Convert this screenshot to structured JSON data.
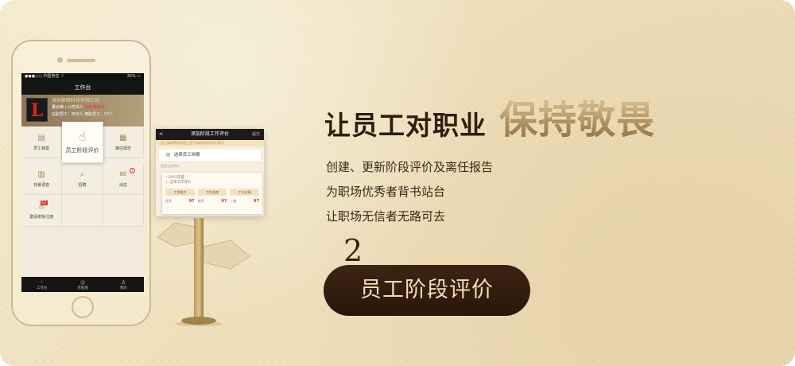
{
  "phone": {
    "status_carrier": "●●●○○ 中国电信 ⌔",
    "status_battery": "35% ▭",
    "app_title": "工作台",
    "company": {
      "logo_letter": "L",
      "name": "深圳泉眼科技有限公司",
      "owner_line": "董云峰 | 公司法人",
      "cert_status": "认证审核中",
      "stats_line": "在职员工：850人  离职员工：57人"
    },
    "grid": [
      {
        "label": "员工档案",
        "icon": "folder-icon"
      },
      {
        "label": "员工阶段评价",
        "icon": "thumbs-up-icon"
      },
      {
        "label": "离任报告",
        "icon": "report-icon"
      },
      {
        "label": "背景调查",
        "icon": "document-icon"
      },
      {
        "label": "招聘",
        "icon": "search-icon"
      },
      {
        "label": "消息",
        "icon": "mail-icon"
      },
      {
        "label": "邀请老板注册",
        "icon": "invite-icon"
      }
    ],
    "grid_badge": "2",
    "invite_tag": "5元",
    "tabs": [
      {
        "label": "工作台",
        "icon": "grid-icon"
      },
      {
        "label": "老板圈",
        "icon": "circle-icon"
      },
      {
        "label": "我的",
        "icon": "person-icon"
      }
    ]
  },
  "popup": {
    "title": "添加阶段工作评价",
    "back": "<",
    "done": "提交",
    "tip": "员工离职将收到您上述已有的阶段性评价提示",
    "select_label": "选择员工档案",
    "section_label": "阶段工作评价",
    "year": "* 2015年度",
    "inner_sub": "○ 全年工作评价",
    "buttons": [
      "工作能力",
      "工作态度",
      "工作业绩"
    ],
    "scores": [
      {
        "label": "优秀",
        "value": "97"
      },
      {
        "label": "良好",
        "value": "97"
      },
      {
        "label": "一般",
        "value": "97"
      }
    ]
  },
  "headline": {
    "part1": "让员工对职业",
    "part2": "保持敬畏"
  },
  "lines": [
    "创建、更新阶段评价及离任报告",
    "为职场优秀者背书站台",
    "让职场无信者无路可去"
  ],
  "step_number": "2",
  "pill_label": "员工阶段评价",
  "colors": {
    "background": "#efe1bd",
    "dark_brown": "#2a170b",
    "gold": "#a27f44"
  }
}
